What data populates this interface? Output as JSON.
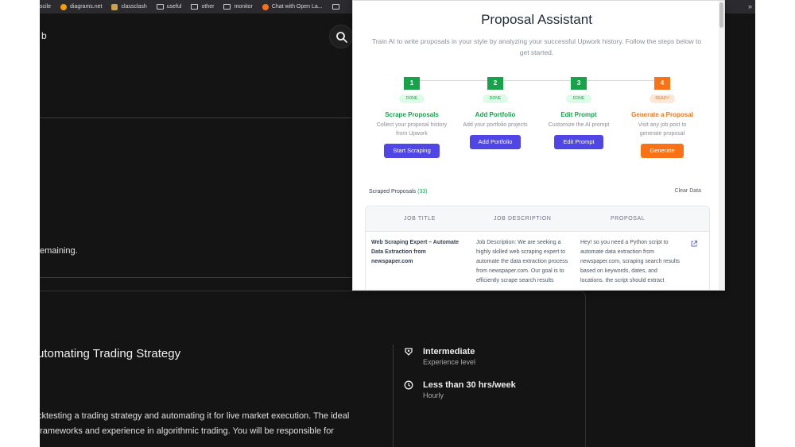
{
  "bookmarks": {
    "items": [
      {
        "label": "scile",
        "icon": "bookmark-icon"
      },
      {
        "label": "diagrams.net",
        "icon": "diagrams-icon"
      },
      {
        "label": "classclash",
        "icon": "classclash-icon"
      },
      {
        "label": "useful",
        "icon": "folder-icon"
      },
      {
        "label": "other",
        "icon": "folder-icon"
      },
      {
        "label": "monitor",
        "icon": "folder-icon"
      },
      {
        "label": "Chat with Open La...",
        "icon": "chat-icon"
      }
    ],
    "more": "»"
  },
  "upwork": {
    "header_label": "b",
    "remaining_text": "emaining.",
    "job": {
      "title": "utomating Trading Strategy",
      "description": "cktesting a trading strategy and automating it for live market execution. The ideal frameworks and experience in algorithmic trading. You will be responsible for",
      "level": "Intermediate",
      "level_sub": "Experience level",
      "hours": "Less than 30 hrs/week",
      "hours_sub": "Hourly"
    }
  },
  "popup": {
    "title": "Proposal Assistant",
    "subtitle": "Train AI to write proposals in your style by analyzing your successful Upwork history. Follow the steps below to get started.",
    "steps": [
      {
        "number": "1",
        "status": "DONE",
        "name": "Scrape Proposals",
        "desc": "Collect your proposal history from Upwork",
        "button": "Start Scraping"
      },
      {
        "number": "2",
        "status": "DONE",
        "name": "Add Portfolio",
        "desc": "Add your portfolio projects",
        "button": "Add Portfolio"
      },
      {
        "number": "3",
        "status": "DONE",
        "name": "Edit Prompt",
        "desc": "Customize the AI prompt",
        "button": "Edit Prompt"
      },
      {
        "number": "4",
        "status": "READY",
        "name": "Generate a Proposal",
        "desc": "Visit any job post to generate proposal",
        "button": "Generate"
      }
    ],
    "scraped_label": "Scraped Proposals",
    "scraped_count": "(33)",
    "clear_label": "Clear Data",
    "table": {
      "headers": [
        "JOB TITLE",
        "JOB DESCRIPTION",
        "PROPOSAL"
      ],
      "rows": [
        {
          "title": "Web Scraping Expert – Automate Data Extraction from newspaper.com",
          "description": "Job Description: We are seeking a highly skilled web scraping expert to automate the data extraction process from newspaper.com. Our goal is to efficiently scrape search results",
          "proposal": "Hey! so you need a Python script to automate data extraction from newspaper.com, scraping search results based on keywords, dates, and locations. the script should extract"
        }
      ]
    }
  },
  "colors": {
    "accent": "#4f46e5",
    "done": "#16a34a",
    "ready": "#f97316",
    "page_bg": "#141414"
  }
}
